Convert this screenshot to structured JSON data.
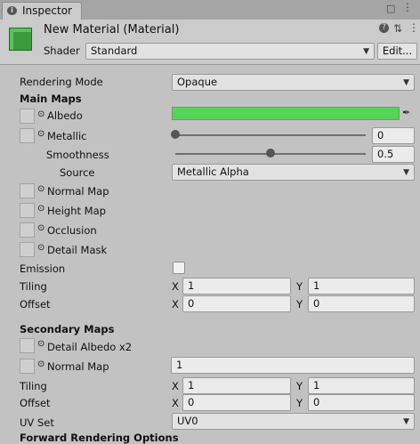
{
  "tab": {
    "title": "Inspector"
  },
  "header": {
    "title": "New Material (Material)",
    "shader_label": "Shader",
    "shader_value": "Standard",
    "edit_label": "Edit..."
  },
  "rendering_mode": {
    "label": "Rendering Mode",
    "value": "Opaque"
  },
  "main_maps": {
    "title": "Main Maps",
    "albedo": {
      "label": "Albedo",
      "color": "#55d555"
    },
    "metallic": {
      "label": "Metallic",
      "value": "0"
    },
    "smoothness": {
      "label": "Smoothness",
      "value": "0.5"
    },
    "source": {
      "label": "Source",
      "value": "Metallic Alpha"
    },
    "normal_map": "Normal Map",
    "height_map": "Height Map",
    "occlusion": "Occlusion",
    "detail_mask": "Detail Mask",
    "emission": "Emission",
    "tiling": {
      "label": "Tiling",
      "x_label": "X",
      "x": "1",
      "y_label": "Y",
      "y": "1"
    },
    "offset": {
      "label": "Offset",
      "x_label": "X",
      "x": "0",
      "y_label": "Y",
      "y": "0"
    }
  },
  "secondary_maps": {
    "title": "Secondary Maps",
    "detail_albedo": "Detail Albedo x2",
    "normal_map": {
      "label": "Normal Map",
      "value": "1"
    },
    "tiling": {
      "label": "Tiling",
      "x_label": "X",
      "x": "1",
      "y_label": "Y",
      "y": "1"
    },
    "offset": {
      "label": "Offset",
      "x_label": "X",
      "x": "0",
      "y_label": "Y",
      "y": "0"
    },
    "uv_set": {
      "label": "UV Set",
      "value": "UV0"
    }
  },
  "forward_rendering": {
    "title": "Forward Rendering Options"
  }
}
